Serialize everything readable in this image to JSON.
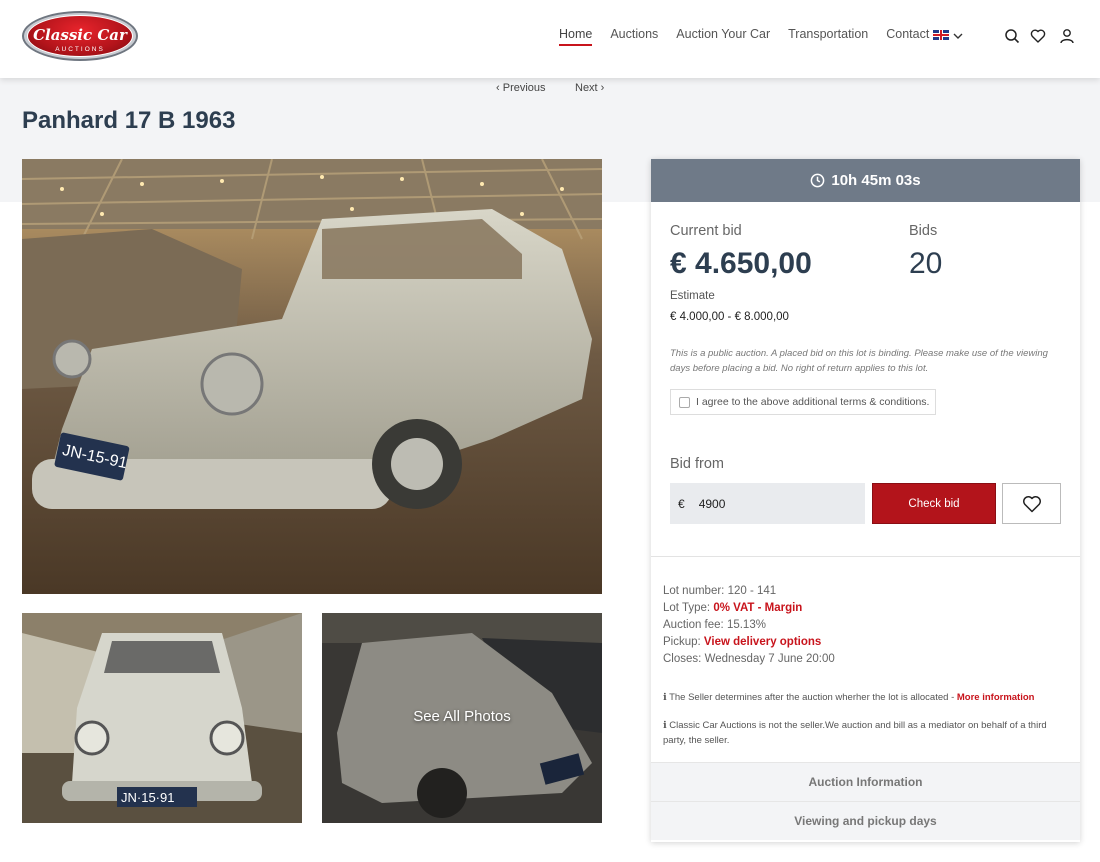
{
  "header": {
    "logo": {
      "line1": "Classic Car",
      "line2": "AUCTIONS"
    },
    "nav": [
      "Home",
      "Auctions",
      "Auction Your Car",
      "Transportation",
      "Contact"
    ],
    "active_nav": "Home",
    "language": "en",
    "icons": [
      "search-icon",
      "heart-icon",
      "user-icon"
    ]
  },
  "pager": {
    "previous": "Previous",
    "next": "Next"
  },
  "lot": {
    "title": "Panhard 17 B 1963",
    "photos": {
      "see_all": "See All Photos"
    }
  },
  "bid_panel": {
    "timer": "10h 45m 03s",
    "current_bid_label": "Current bid",
    "current_bid": "€ 4.650,00",
    "bids_label": "Bids",
    "bids": "20",
    "estimate_label": "Estimate",
    "estimate": "€ 4.000,00 - € 8.000,00",
    "notice": "This is a public auction. A placed bid on this lot is binding. Please make use of the viewing days before placing a bid. No right of return applies to this lot.",
    "terms_label": "I agree to the above additional terms & conditions.",
    "bid_from_label": "Bid from",
    "currency": "€",
    "bid_value": "4900",
    "check_bid": "Check bid",
    "lot_number_label": "Lot number:",
    "lot_number": "120 - 141",
    "lot_type_label": "Lot Type:",
    "lot_type": "0% VAT - Margin",
    "auction_fee_label": "Auction fee:",
    "auction_fee": "15.13%",
    "pickup_label": "Pickup:",
    "pickup_link": "View delivery options",
    "closes_label": "Closes:",
    "closes": "Wednesday 7 June 20:00",
    "note1": "The Seller determines after the auction wherher the lot is allocated -",
    "note1_link": "More information",
    "note2": "Classic Car Auctions is not the seller.We auction and bill as a mediator on behalf of a third party, the seller.",
    "accordion": [
      "Auction Information",
      "Viewing and pickup days"
    ]
  },
  "colors": {
    "accent": "#c8141c",
    "timer_bg": "#6f7a88",
    "title": "#2d3e50"
  }
}
